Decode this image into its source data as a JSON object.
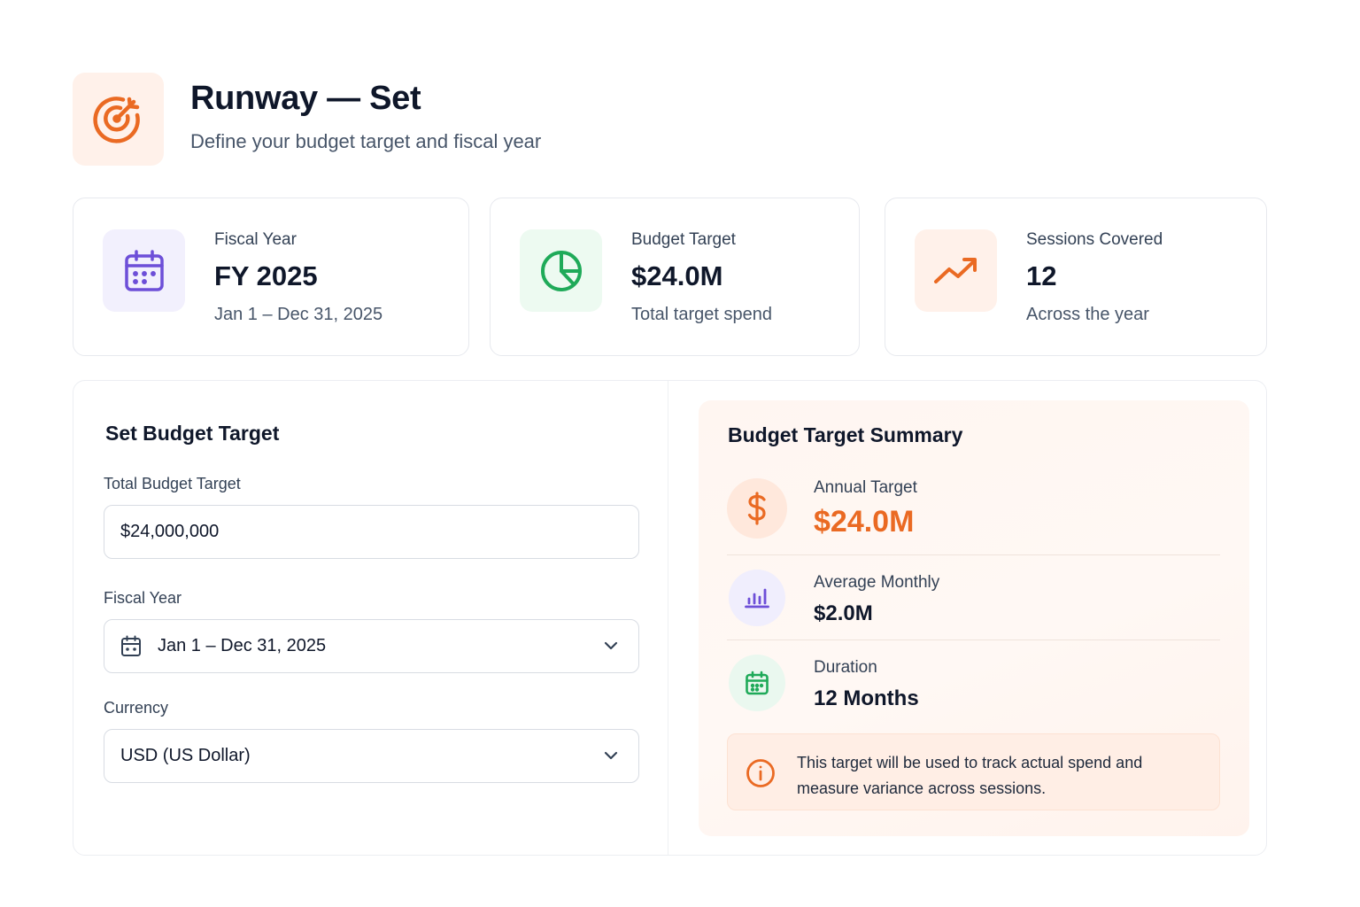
{
  "header": {
    "title": "Runway — Set",
    "subtitle": "Define your budget target and fiscal year",
    "logo_icon": "target-icon"
  },
  "stats": [
    {
      "label": "Fiscal Year",
      "value": "FY 2025",
      "sub": "Jan 1 – Dec 31, 2025",
      "icon": "calendar-icon",
      "color": "#6d4fd8",
      "bg": "#f2f0fd"
    },
    {
      "label": "Budget Target",
      "value": "$24.0M",
      "sub": "Total target spend",
      "icon": "pie-chart-icon",
      "color": "#1faa59",
      "bg": "#edfaf1"
    },
    {
      "label": "Sessions Covered",
      "value": "12",
      "sub": "Across the year",
      "icon": "trending-up-icon",
      "color": "#ea6a23",
      "bg": "#fff1ea"
    }
  ],
  "form": {
    "title": "Set Budget Target",
    "budget_label": "Total Budget Target",
    "budget_value": "$24,000,000",
    "fiscal_label": "Fiscal Year",
    "fiscal_value": "Jan 1 – Dec 31, 2025",
    "currency_label": "Currency",
    "currency_value": "USD (US Dollar)"
  },
  "summary": {
    "title": "Budget Target Summary",
    "rows": [
      {
        "label": "Annual Target",
        "value": "$24.0M",
        "icon": "dollar-icon"
      },
      {
        "label": "Average Monthly",
        "value": "$2.0M",
        "icon": "bar-chart-icon"
      },
      {
        "label": "Duration",
        "value": "12 Months",
        "icon": "calendar-icon"
      }
    ],
    "note": "This target will be used to track actual spend and measure variance across sessions.",
    "note_icon": "info-icon"
  },
  "colors": {
    "accent": "#ea6a23",
    "purple": "#6d4fd8",
    "green": "#1faa59"
  }
}
